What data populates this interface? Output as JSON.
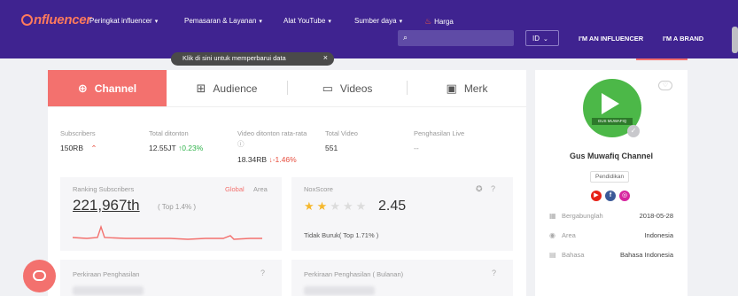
{
  "nav": {
    "logo": "nfluencer",
    "menu": [
      {
        "label": "Peringkat influencer"
      },
      {
        "label": "Pemasaran & Layanan"
      },
      {
        "label": "Alat YouTube"
      },
      {
        "label": "Sumber daya"
      },
      {
        "label": "Harga"
      }
    ],
    "lang": "ID",
    "influencer_btn": "I'M AN INFLUENCER",
    "brand_btn": "I'M A BRAND"
  },
  "tooltip": "Klik di sini untuk memperbarui data",
  "tabs": [
    {
      "label": "Channel",
      "icon": "globe-icon"
    },
    {
      "label": "Audience",
      "icon": "grid-icon"
    },
    {
      "label": "Videos",
      "icon": "video-icon"
    },
    {
      "label": "Merk",
      "icon": "box-icon"
    }
  ],
  "stats": {
    "subscribers": {
      "label": "Subscribers",
      "value": "150RB"
    },
    "total_views": {
      "label": "Total ditonton",
      "value": "12.55JT",
      "change": "0.23%"
    },
    "avg_views": {
      "label": "Video ditonton rata-rata",
      "value": "18.34RB",
      "change": "-1.46%"
    },
    "total_video": {
      "label": "Total Video",
      "value": "551"
    },
    "live_income": {
      "label": "Penghasilan Live",
      "value": "--"
    }
  },
  "ranking": {
    "label": "Ranking Subscribers",
    "global": "Global",
    "area": "Area",
    "value": "221,967th",
    "top": "( Top 1.4% )"
  },
  "noxscore": {
    "label": "NoxScore",
    "rating": 2,
    "max": 5,
    "value": "2.45",
    "desc": "Tidak Buruk( Top 1.71% )"
  },
  "earnings": {
    "estimate": "Perkiraan Penghasilan",
    "monthly": "Perkiraan Penghasilan ( Bulanan)"
  },
  "profile": {
    "banner": "GUS MUWAFIQ",
    "name": "Gus Muwafiq Channel",
    "category": "Pendidikan",
    "rows": [
      {
        "icon": "calendar-icon",
        "label": "Bergabunglah",
        "value": "2018-05-28"
      },
      {
        "icon": "location-icon",
        "label": "Area",
        "value": "Indonesia"
      },
      {
        "icon": "language-icon",
        "label": "Bahasa",
        "value": "Bahasa Indonesia"
      }
    ]
  },
  "colors": {
    "nav_bg": "#3f2390",
    "accent": "#f3716e",
    "up": "#2fb34a",
    "down": "#e74c3c",
    "star": "#f5b82e"
  }
}
